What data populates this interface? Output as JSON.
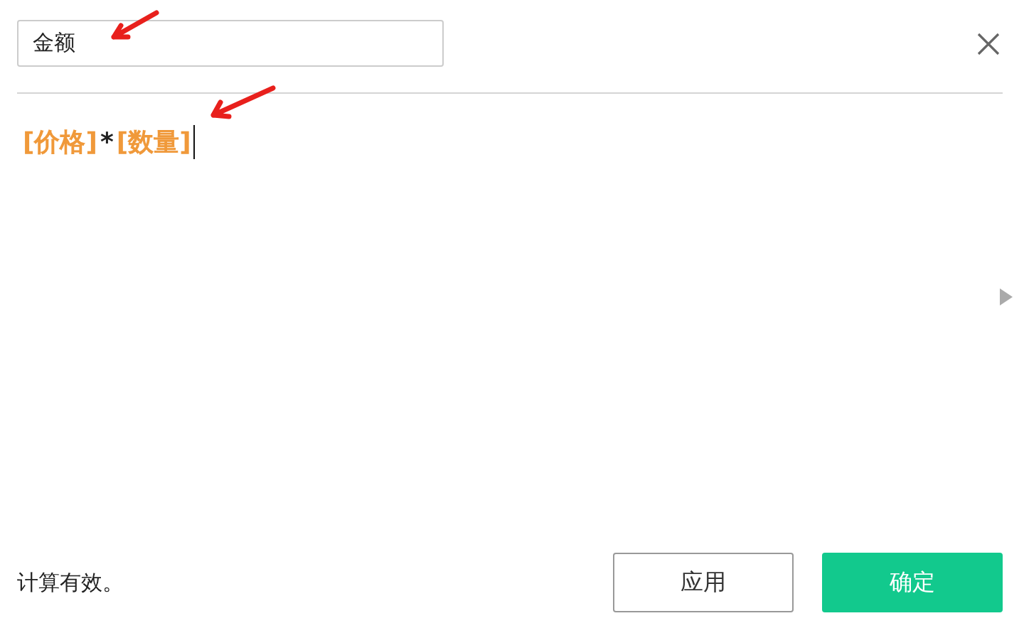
{
  "name_field": {
    "value": "金额"
  },
  "formula": {
    "tokens": [
      {
        "kind": "field",
        "text": "[价格]"
      },
      {
        "kind": "operator",
        "text": "*"
      },
      {
        "kind": "field",
        "text": "[数量]"
      }
    ]
  },
  "status": "计算有效。",
  "buttons": [
    {
      "label": "应用",
      "kind": "secondary"
    },
    {
      "label": "确定",
      "kind": "primary"
    }
  ]
}
